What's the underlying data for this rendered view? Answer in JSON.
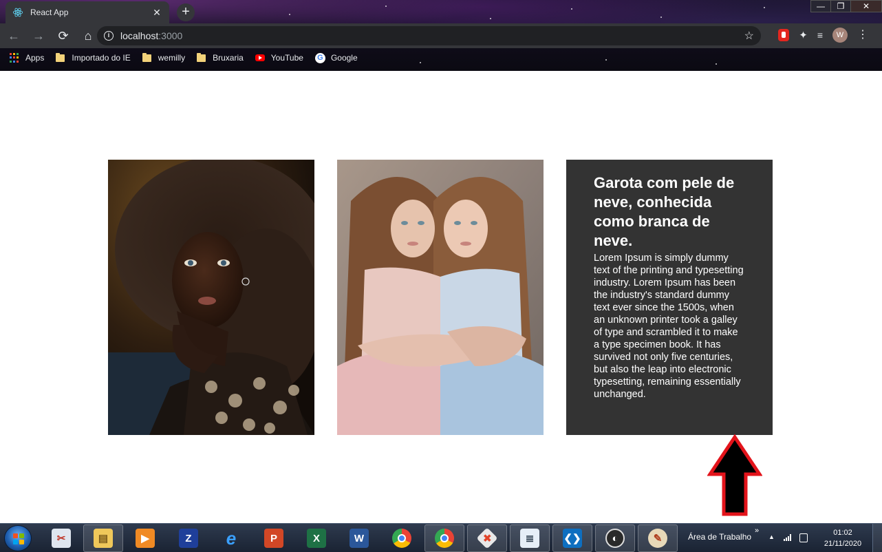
{
  "browser": {
    "tab_title": "React App",
    "tab_close": "✕",
    "new_tab": "+",
    "url_host": "localhost",
    "url_port": ":3000",
    "window_controls": {
      "minimize": "—",
      "restore": "❐",
      "close": "✕"
    },
    "avatar_letter": "W",
    "bookmarks": [
      {
        "label": "Apps",
        "icon": "apps-grid-icon"
      },
      {
        "label": "Importado do IE",
        "icon": "folder-icon"
      },
      {
        "label": "wemilly",
        "icon": "folder-icon"
      },
      {
        "label": "Bruxaria",
        "icon": "folder-icon"
      },
      {
        "label": "YouTube",
        "icon": "youtube-icon"
      },
      {
        "label": "Google",
        "icon": "google-icon"
      }
    ]
  },
  "page": {
    "cards": [
      {
        "image": "portrait-girl-curly-hair"
      },
      {
        "image": "twin-girls-hugging"
      }
    ],
    "text_card": {
      "title": "Garota com pele de neve, conhecida como branca de neve.",
      "body": "Lorem Ipsum is simply dummy text of the printing and typesetting industry. Lorem Ipsum has been the industry's standard dummy text ever since the 1500s, when an unknown printer took a galley of type and scrambled it to make a type specimen book. It has survived not only five centuries, but also the leap into electronic typesetting, remaining essentially unchanged.",
      "background": "#333333"
    },
    "annotation": {
      "icon": "red-arrow-up-icon",
      "color": "#e3141b"
    }
  },
  "taskbar": {
    "apps": [
      "paint-icon",
      "file-explorer-icon",
      "media-player-icon",
      "app-blue-icon",
      "internet-explorer-icon",
      "powerpoint-icon",
      "excel-icon",
      "word-icon",
      "chrome-icon",
      "chrome-profile-icon",
      "git-icon",
      "notepad-icon",
      "vscode-icon",
      "obs-icon",
      "paint-palette-icon"
    ],
    "tray_label": "Área de Trabalho",
    "tray_chevron": "»",
    "time": "01:02",
    "date": "21/11/2020"
  }
}
